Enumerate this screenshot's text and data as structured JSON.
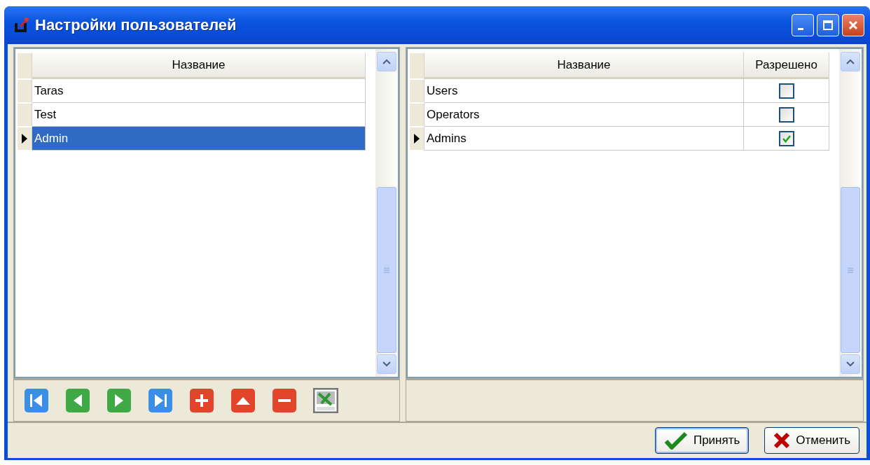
{
  "window": {
    "title": "Настройки пользователей"
  },
  "users_grid": {
    "columns": [
      "Название"
    ],
    "rows": [
      {
        "name": "Taras",
        "selected": false
      },
      {
        "name": "Test",
        "selected": false
      },
      {
        "name": "Admin",
        "selected": true
      }
    ]
  },
  "toolbar": [
    {
      "kind": "first"
    },
    {
      "kind": "prev"
    },
    {
      "kind": "next"
    },
    {
      "kind": "last"
    },
    {
      "kind": "add"
    },
    {
      "kind": "up"
    },
    {
      "kind": "remove"
    },
    {
      "kind": "export"
    }
  ],
  "groups_grid": {
    "columns": [
      "Название",
      "Разрешено"
    ],
    "rows": [
      {
        "name": "Users",
        "checked": false,
        "selected": false
      },
      {
        "name": "Operators",
        "checked": false,
        "selected": false
      },
      {
        "name": "Admins",
        "checked": true,
        "selected": true
      }
    ]
  },
  "buttons": [
    {
      "kind": "ok",
      "label": "Принять"
    },
    {
      "kind": "cancel",
      "label": "Отменить"
    }
  ]
}
